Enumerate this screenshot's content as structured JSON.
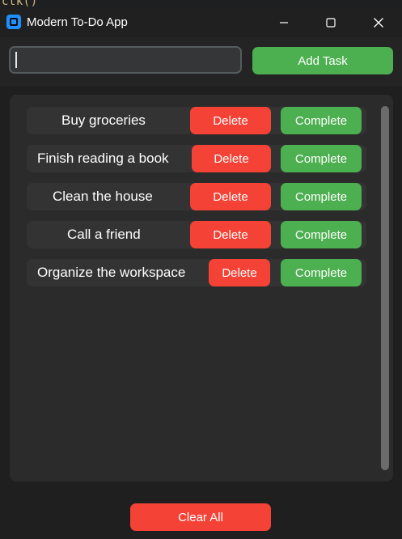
{
  "background_code_fragment": "ctk()",
  "window": {
    "title": "Modern To-Do App",
    "app_icon": "app-icon",
    "controls": {
      "minimize_icon": "minimize-icon",
      "maximize_icon": "maximize-icon",
      "close_icon": "close-icon"
    }
  },
  "input": {
    "value": "",
    "placeholder": ""
  },
  "add_button_label": "Add Task",
  "tasks": [
    {
      "label": "Buy groceries",
      "delete_label": "Delete",
      "complete_label": "Complete"
    },
    {
      "label": "Finish reading a book",
      "delete_label": "Delete",
      "complete_label": "Complete"
    },
    {
      "label": "Clean the house",
      "delete_label": "Delete",
      "complete_label": "Complete"
    },
    {
      "label": "Call a friend",
      "delete_label": "Delete",
      "complete_label": "Complete"
    },
    {
      "label": "Organize the workspace",
      "delete_label": "Delete",
      "complete_label": "Complete"
    }
  ],
  "clear_all_label": "Clear All",
  "colors": {
    "delete": "#f44336",
    "complete": "#4caf50",
    "accent_icon": "#1e90ff",
    "background": "#1f1f1f"
  }
}
